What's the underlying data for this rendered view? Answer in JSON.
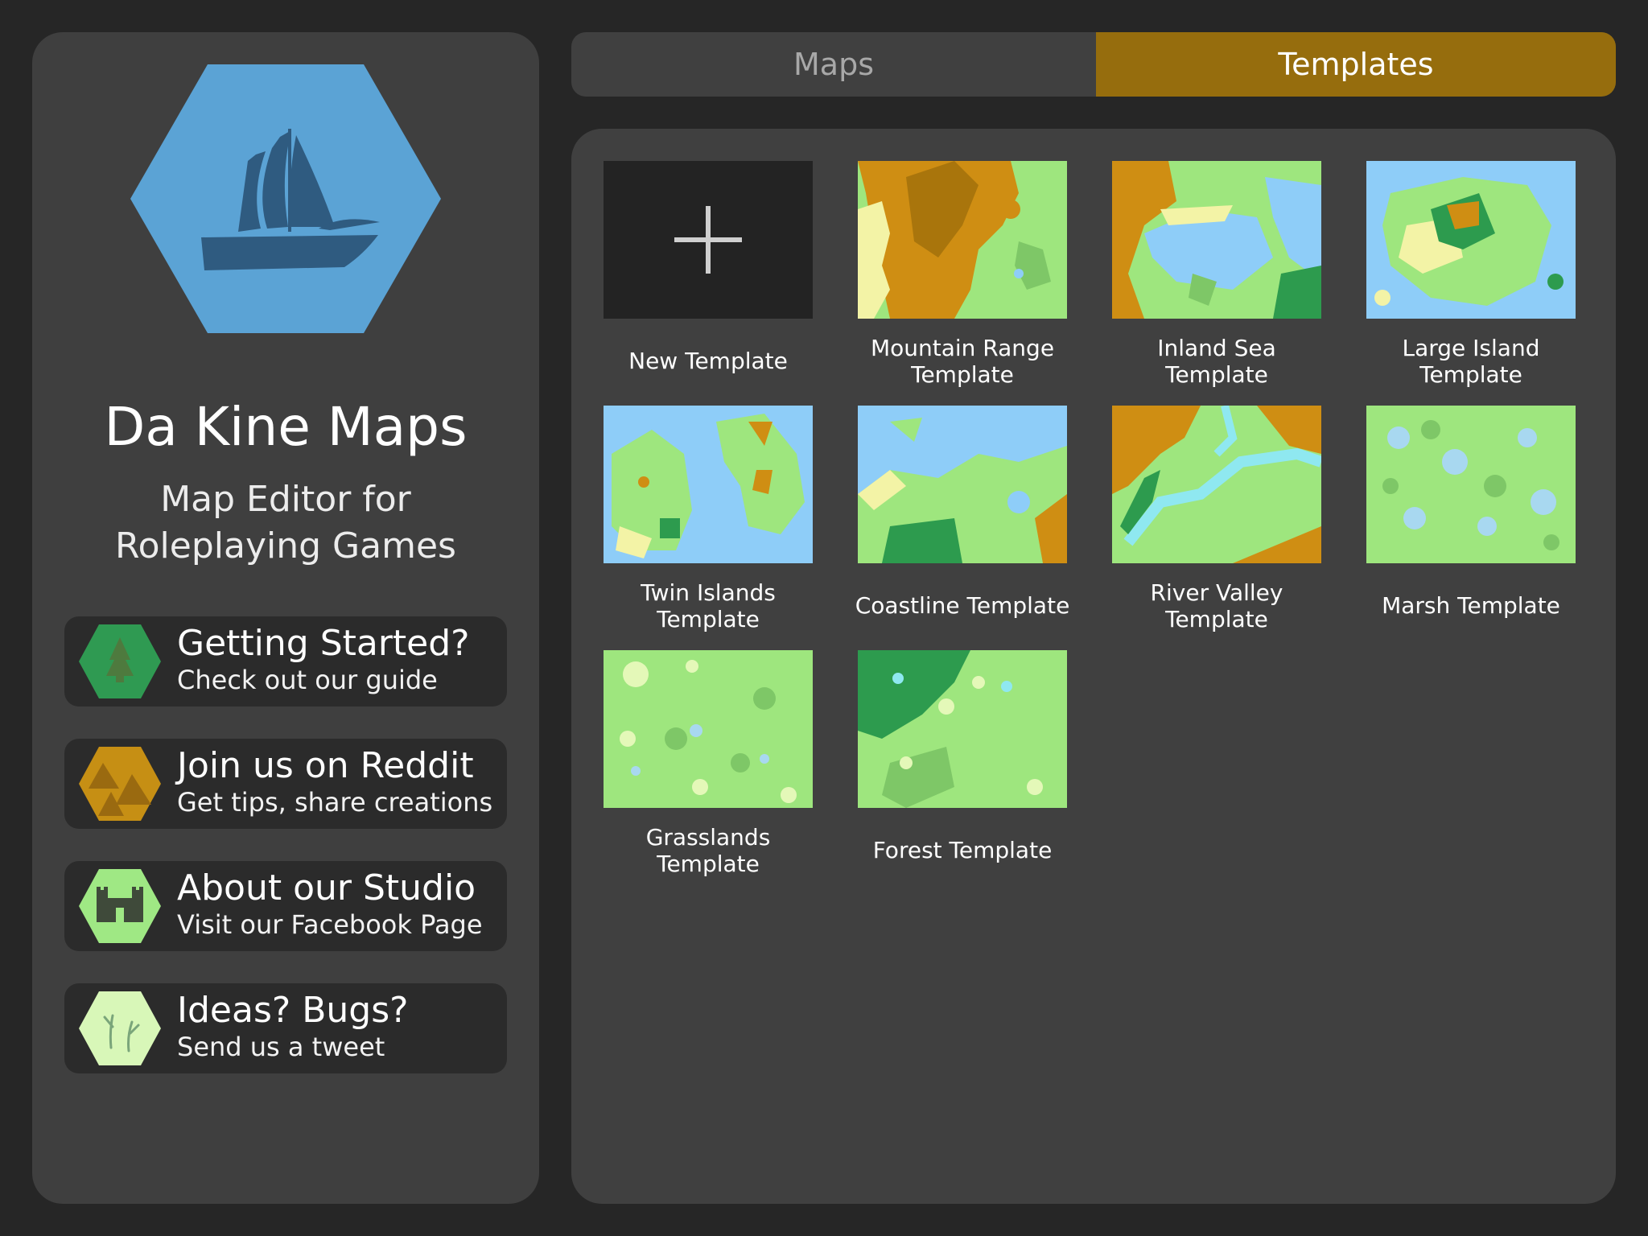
{
  "app": {
    "title": "Da Kine Maps",
    "subtitle_line1": "Map Editor for",
    "subtitle_line2": "Roleplaying Games",
    "logo_icon": "sailing-ship-icon"
  },
  "links": [
    {
      "title": "Getting Started?",
      "subtitle": "Check out our guide",
      "icon": "pine-tree-hex-icon",
      "color": "#2f9a52"
    },
    {
      "title": "Join us on Reddit",
      "subtitle": "Get tips, share creations",
      "icon": "mountains-hex-icon",
      "color": "#c68f14"
    },
    {
      "title": "About our Studio",
      "subtitle": "Visit our Facebook Page",
      "icon": "castle-hex-icon",
      "color": "#9fe884"
    },
    {
      "title": "Ideas? Bugs?",
      "subtitle": "Send us a tweet",
      "icon": "grass-sprouts-hex-icon",
      "color": "#d8f7b8"
    }
  ],
  "tabs": {
    "maps": "Maps",
    "templates": "Templates",
    "selected": "Templates"
  },
  "templates": [
    {
      "line1": "New Template",
      "line2": "",
      "icon": "plus-icon"
    },
    {
      "line1": "Mountain Range",
      "line2": "Template"
    },
    {
      "line1": "Inland Sea",
      "line2": "Template"
    },
    {
      "line1": "Large Island",
      "line2": "Template"
    },
    {
      "line1": "Twin Islands",
      "line2": "Template"
    },
    {
      "line1": "Coastline Template",
      "line2": ""
    },
    {
      "line1": "River Valley",
      "line2": "Template"
    },
    {
      "line1": "Marsh Template",
      "line2": ""
    },
    {
      "line1": "Grasslands",
      "line2": "Template"
    },
    {
      "line1": "Forest Template",
      "line2": ""
    }
  ],
  "colors": {
    "accent": "#966d0d",
    "background": "#262626",
    "panel": "#404040",
    "water": "#8ecdf8",
    "grass": "#9ee67e",
    "forest": "#2d9b4e",
    "desert": "#f3f3a6",
    "mountain": "#cf8e13"
  }
}
